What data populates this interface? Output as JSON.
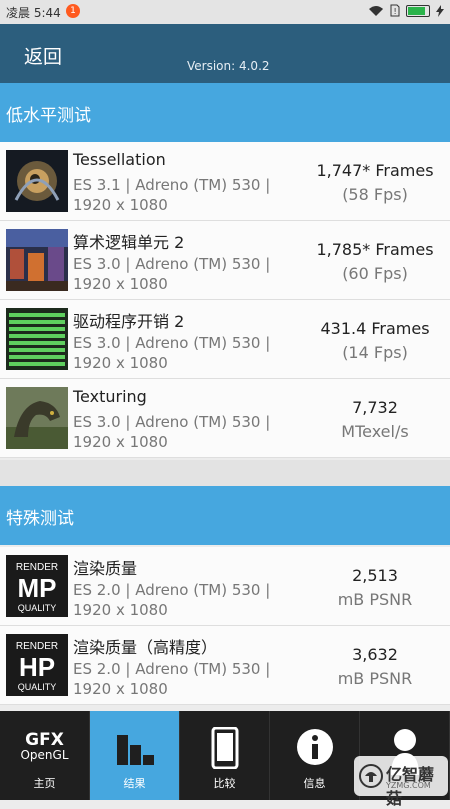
{
  "status": {
    "time": "凌晨 5:44",
    "notif_count": "1"
  },
  "header": {
    "back_label": "返回",
    "version": "Version: 4.0.2"
  },
  "sections": [
    {
      "title": "低水平测试"
    },
    {
      "title": "特殊测试"
    }
  ],
  "tests": [
    {
      "name": "Tessellation",
      "spec": "ES 3.1 | Adreno (TM) 530 | 1920 x 1080",
      "score": "1,747* Frames",
      "sub": "(58 Fps)"
    },
    {
      "name": "算术逻辑单元 2",
      "spec": "ES 3.0 | Adreno (TM) 530 | 1920 x 1080",
      "score": "1,785* Frames",
      "sub": "(60 Fps)"
    },
    {
      "name": "驱动程序开销 2",
      "spec": "ES 3.0 | Adreno (TM) 530 | 1920 x 1080",
      "score": "431.4 Frames",
      "sub": "(14 Fps)"
    },
    {
      "name": "Texturing",
      "spec": "ES 3.0 | Adreno (TM) 530 | 1920 x 1080",
      "score": "7,732",
      "sub": "MTexel/s"
    },
    {
      "name": "渲染质量",
      "spec": "ES 2.0 | Adreno (TM) 530 | 1920 x 1080",
      "score": "2,513",
      "sub": "mB PSNR",
      "thumb_top": "RENDER",
      "thumb_big": "MP",
      "thumb_bottom": "QUALITY"
    },
    {
      "name": "渲染质量（高精度）",
      "spec": "ES 2.0 | Adreno (TM) 530 | 1920 x 1080",
      "score": "3,632",
      "sub": "mB PSNR",
      "thumb_top": "RENDER",
      "thumb_big": "HP",
      "thumb_bottom": "QUALITY"
    }
  ],
  "tabs": [
    {
      "label": "主页",
      "logo_big": "GFX",
      "logo_small": "OpenGL"
    },
    {
      "label": "结果"
    },
    {
      "label": "比较"
    },
    {
      "label": "信息"
    },
    {
      "label": ""
    }
  ],
  "watermark": {
    "text": "亿智蘑菇",
    "sub": "YZMG.COM"
  },
  "colors": {
    "appbar": "#2c5e7d",
    "section": "#46a7df",
    "tabbar": "#1f1f1f",
    "active_tab": "#46a7df"
  }
}
